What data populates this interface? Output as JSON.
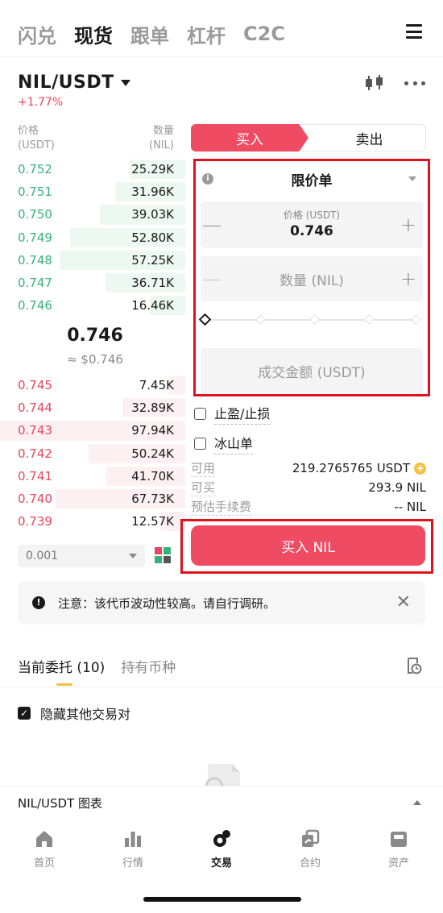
{
  "top_nav": {
    "tabs": [
      "闪兑",
      "现货",
      "跟单",
      "杠杆",
      "C2C"
    ],
    "active": 1
  },
  "pair": {
    "name": "NIL/USDT",
    "change": "+1.77%"
  },
  "orderbook": {
    "header": {
      "price_label": "价格",
      "price_unit": "(USDT)",
      "qty_label": "数量",
      "qty_unit": "(NIL)"
    },
    "asks": [
      {
        "price": "0.752",
        "qty": "25.29K",
        "depth": 0.3
      },
      {
        "price": "0.751",
        "qty": "31.96K",
        "depth": 0.38
      },
      {
        "price": "0.750",
        "qty": "39.03K",
        "depth": 0.46
      },
      {
        "price": "0.749",
        "qty": "52.80K",
        "depth": 0.62
      },
      {
        "price": "0.748",
        "qty": "57.25K",
        "depth": 0.68
      },
      {
        "price": "0.747",
        "qty": "36.71K",
        "depth": 0.43
      },
      {
        "price": "0.746",
        "qty": "16.46K",
        "depth": 0.19
      }
    ],
    "mid_price": "0.746",
    "mid_usd": "≈ $0.746",
    "bids": [
      {
        "price": "0.745",
        "qty": "7.45K",
        "depth": 0.09
      },
      {
        "price": "0.744",
        "qty": "32.89K",
        "depth": 0.34
      },
      {
        "price": "0.743",
        "qty": "97.94K",
        "depth": 1.0
      },
      {
        "price": "0.742",
        "qty": "50.24K",
        "depth": 0.52
      },
      {
        "price": "0.741",
        "qty": "41.70K",
        "depth": 0.43
      },
      {
        "price": "0.740",
        "qty": "67.73K",
        "depth": 0.7
      },
      {
        "price": "0.739",
        "qty": "12.57K",
        "depth": 0.13
      }
    ],
    "depth_value": "0.001"
  },
  "trade_form": {
    "buy_tab": "买入",
    "sell_tab": "卖出",
    "order_type": "限价单",
    "price_label": "价格 (USDT)",
    "price_value": "0.746",
    "qty_placeholder": "数量 (NIL)",
    "total_placeholder": "成交金额 (USDT)",
    "tp_sl_label": "止盈/止损",
    "iceberg_label": "冰山单",
    "available_label": "可用",
    "available_value": "219.2765765 USDT",
    "can_buy_label": "可买",
    "can_buy_value": "293.9 NIL",
    "fee_label": "预估手续费",
    "fee_value": "-- NIL",
    "buy_button": "买入 NIL"
  },
  "notice": {
    "text": "注意：该代币波动性较高。请自行调研。"
  },
  "orders": {
    "tabs": [
      "当前委托 (10)",
      "持有币种"
    ],
    "hide_others_label": "隐藏其他交易对"
  },
  "chart_bar": {
    "label": "NIL/USDT 图表"
  },
  "bottom_nav": [
    {
      "label": "首页"
    },
    {
      "label": "行情"
    },
    {
      "label": "交易"
    },
    {
      "label": "合约"
    },
    {
      "label": "资产"
    }
  ],
  "colors": {
    "buy": "#ef4b62",
    "ask": "#35b27a",
    "accent": "#f5c042",
    "highlight_border": "#e0101e"
  }
}
